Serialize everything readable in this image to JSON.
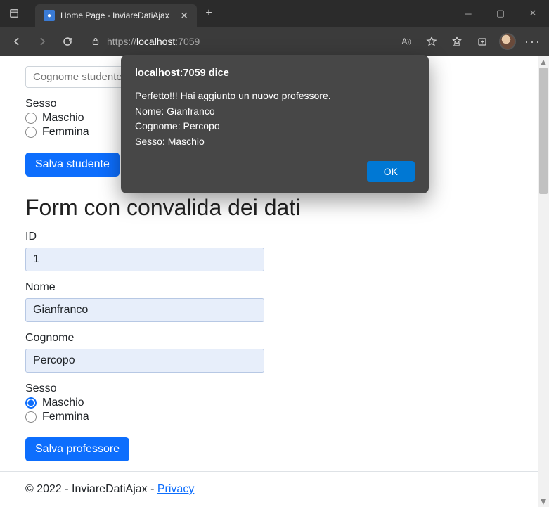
{
  "browser": {
    "tab_title": "Home Page - InviareDatiAjax",
    "url_prefix": "https://",
    "url_host": "localhost",
    "url_port": ":7059"
  },
  "alert": {
    "title": "localhost:7059 dice",
    "message": "Perfetto!!! Hai aggiunto un nuovo professore.\nNome: Gianfranco\nCognome: Percopo\nSesso: Maschio",
    "ok": "OK"
  },
  "form1": {
    "cognome_placeholder": "Cognome studente",
    "sesso_label": "Sesso",
    "opt_m": "Maschio",
    "opt_f": "Femmina",
    "submit": "Salva studente"
  },
  "form2": {
    "title": "Form con convalida dei dati",
    "id_label": "ID",
    "id_value": "1",
    "nome_label": "Nome",
    "nome_value": "Gianfranco",
    "cognome_label": "Cognome",
    "cognome_value": "Percopo",
    "sesso_label": "Sesso",
    "opt_m": "Maschio",
    "opt_f": "Femmina",
    "submit": "Salva professore"
  },
  "footer": {
    "text": "© 2022 - InviareDatiAjax - ",
    "privacy": "Privacy"
  }
}
